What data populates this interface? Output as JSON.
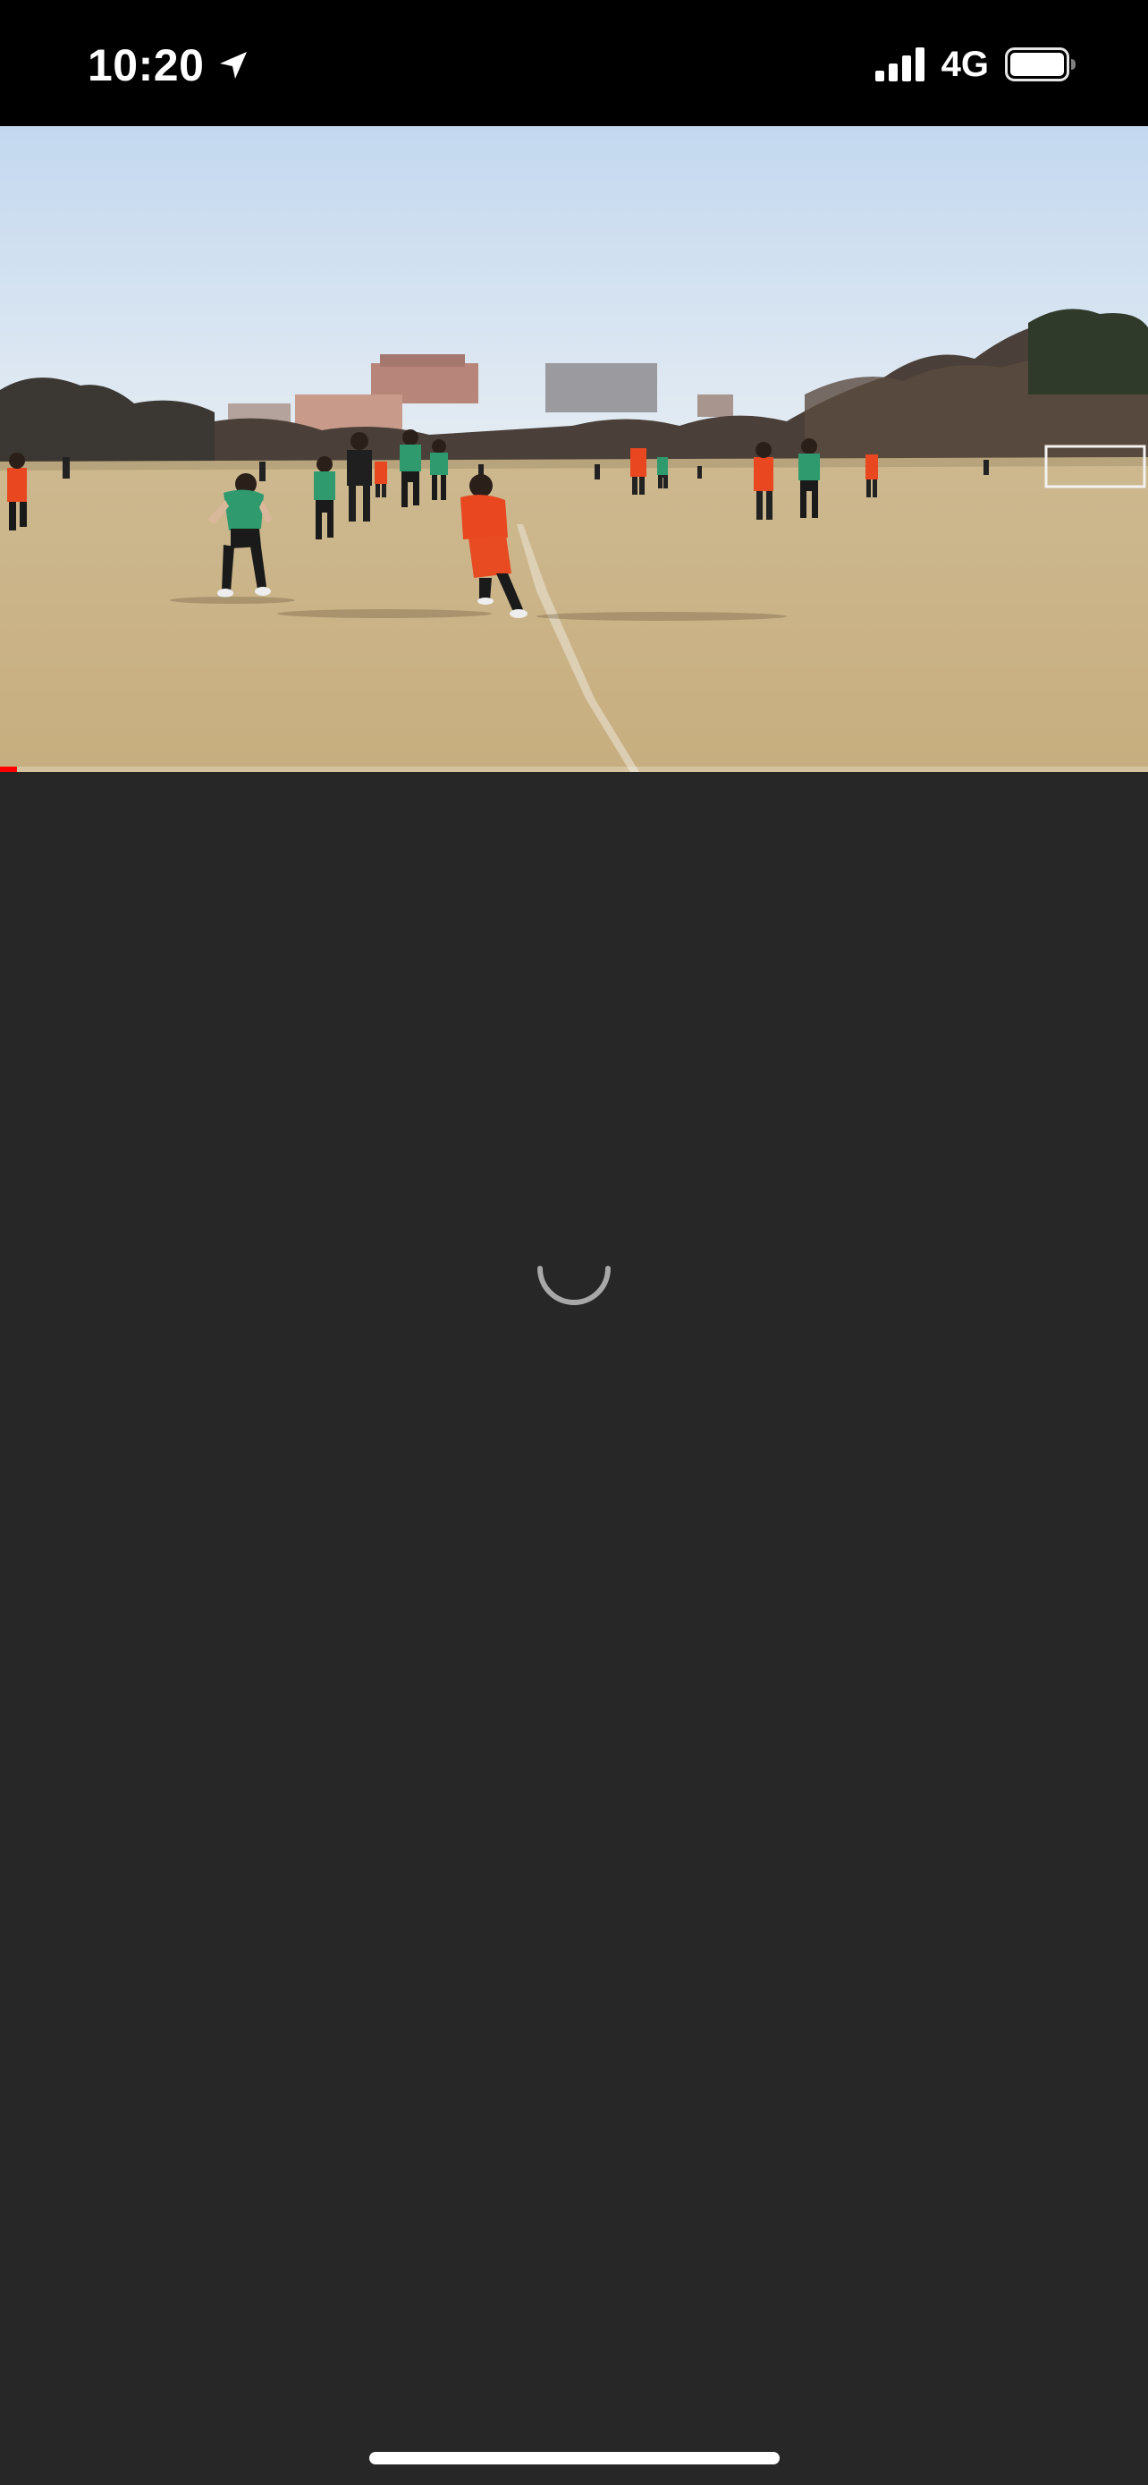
{
  "status_bar": {
    "time": "10:20",
    "location_icon": "location-arrow-icon",
    "signal_icon": "cellular-signal-icon",
    "network": "4G",
    "battery_icon": "battery-full-icon"
  },
  "video": {
    "scene": "youth-soccer-match",
    "progress_fraction": 0.015,
    "progress_color": "#ff0000",
    "loading": true
  },
  "spinner": {
    "icon": "loading-spinner-icon"
  },
  "colors": {
    "background": "#272727",
    "status_bar": "#000000",
    "accent": "#ff0000"
  }
}
